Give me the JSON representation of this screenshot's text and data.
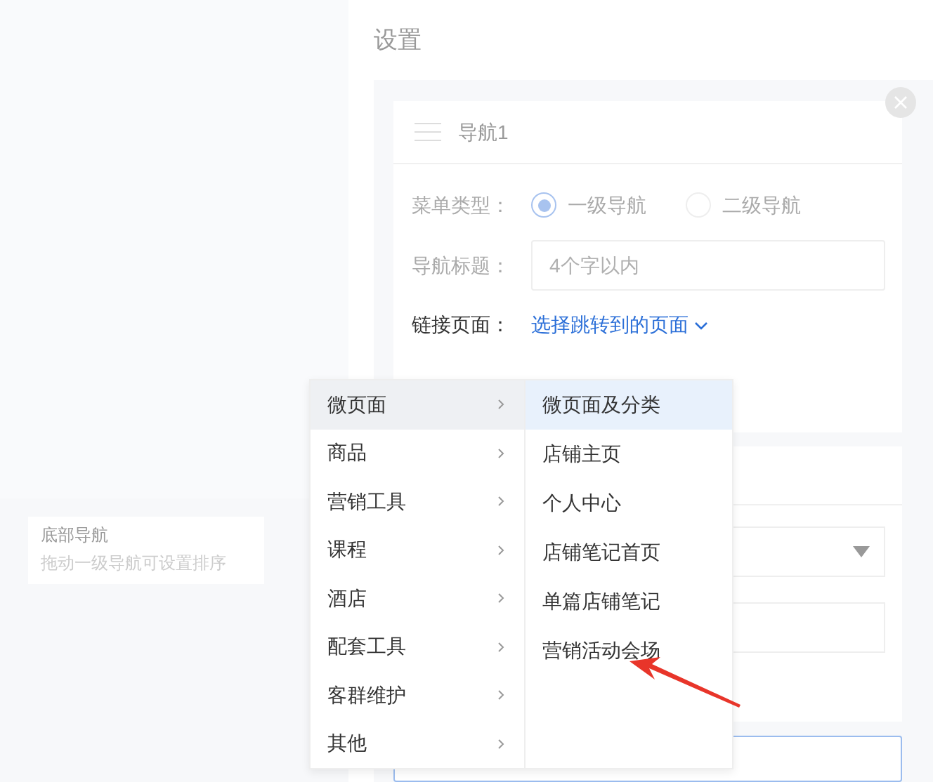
{
  "settings_title": "设置",
  "nav_card": {
    "title": "导航1",
    "menu_type": {
      "label": "菜单类型：",
      "options": [
        {
          "label": "一级导航",
          "selected": true
        },
        {
          "label": "二级导航",
          "selected": false
        }
      ]
    },
    "nav_title": {
      "label": "导航标题：",
      "placeholder": "4个字以内"
    },
    "link_page": {
      "label": "链接页面：",
      "value": "选择跳转到的页面"
    }
  },
  "bottom_nav": {
    "title": "底部导航",
    "hint": "拖动一级导航可设置排序"
  },
  "menu": {
    "categories": [
      {
        "label": "微页面",
        "selected": true
      },
      {
        "label": "商品",
        "selected": false
      },
      {
        "label": "营销工具",
        "selected": false
      },
      {
        "label": "课程",
        "selected": false
      },
      {
        "label": "酒店",
        "selected": false
      },
      {
        "label": "配套工具",
        "selected": false
      },
      {
        "label": "客群维护",
        "selected": false
      },
      {
        "label": "其他",
        "selected": false
      }
    ],
    "items": [
      {
        "label": "微页面及分类",
        "selected": true
      },
      {
        "label": "店铺主页",
        "selected": false
      },
      {
        "label": "个人中心",
        "selected": false
      },
      {
        "label": "店铺笔记首页",
        "selected": false
      },
      {
        "label": "单篇店铺笔记",
        "selected": false
      },
      {
        "label": "营销活动会场",
        "selected": false
      }
    ]
  }
}
